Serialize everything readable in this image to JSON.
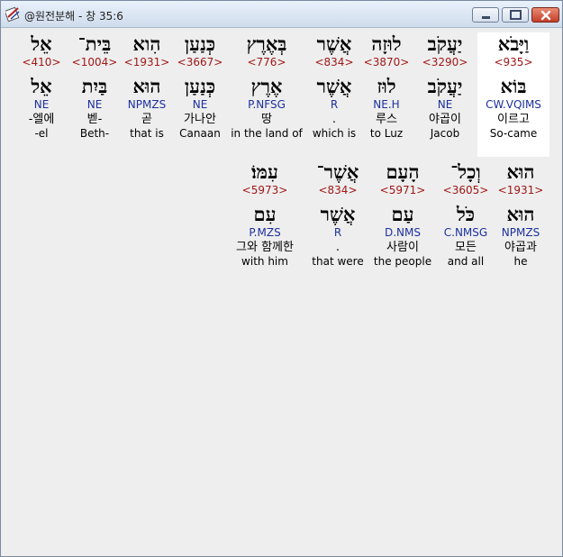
{
  "window": {
    "title": "@원전분해 - 창 35:6"
  },
  "colors": {
    "strong_number": "#a01818",
    "parsing": "#1c2fa0",
    "highlight_background": "#ffffff"
  },
  "rows": [
    {
      "words": [
        {
          "heb": "וַיָּבֹא",
          "num": "<935>",
          "lemma": "בּוֹא",
          "parse": "CW.VQIMS",
          "kor": "이르고",
          "eng": "So-came"
        },
        {
          "heb": "יַעֲקֹב",
          "num": "<3290>",
          "lemma": "יַעֲקֹב",
          "parse": "NE",
          "kor": "야곱이",
          "eng": "Jacob"
        },
        {
          "heb": "לוּזָה",
          "num": "<3870>",
          "lemma": "לוּז",
          "parse": "NE.H",
          "kor": "루스",
          "eng": "to Luz"
        },
        {
          "heb": "אֲשֶׁר",
          "num": "<834>",
          "lemma": "אֲשֶׁר",
          "parse": "R",
          "kor": ".",
          "eng": "which is"
        },
        {
          "heb": "בְּאֶרֶץ",
          "num": "<776>",
          "lemma": "אֶרֶץ",
          "parse": "P.NFSG",
          "kor": "땅",
          "eng": "in the land of"
        },
        {
          "heb": "כְּנַעַן",
          "num": "<3667>",
          "lemma": "כְּנַעַן",
          "parse": "NE",
          "kor": "가나안",
          "eng": "Canaan"
        },
        {
          "heb": "הִוא",
          "num": "<1931>",
          "lemma": "הוּא",
          "parse": "NPMZS",
          "kor": "곧",
          "eng": "that is"
        },
        {
          "heb": "בֵּית־",
          "num": "<1004>",
          "lemma": "בַּיִת",
          "parse": "NE",
          "kor": "벧-",
          "eng": "Beth-"
        },
        {
          "heb": "אֵל",
          "num": "<410>",
          "lemma": "אֵל",
          "parse": "NE",
          "kor": "-엘에",
          "eng": "-el"
        }
      ]
    },
    {
      "words": [
        {
          "heb": "הוּא",
          "num": "<1931>",
          "lemma": "הוּא",
          "parse": "NPMZS",
          "kor": "야곱과",
          "eng": "he"
        },
        {
          "heb": "וְכָל־",
          "num": "<3605>",
          "lemma": "כֹּל",
          "parse": "C.NMSG",
          "kor": "모든",
          "eng": "and all"
        },
        {
          "heb": "הָעָם",
          "num": "<5971>",
          "lemma": "עַם",
          "parse": "D.NMS",
          "kor": "사람이",
          "eng": "the people"
        },
        {
          "heb": "אֲשֶׁר־",
          "num": "<834>",
          "lemma": "אֲשֶׁר",
          "parse": "R",
          "kor": ".",
          "eng": "that were"
        },
        {
          "heb": "עִמּוֹ׃",
          "num": "<5973>",
          "lemma": "עִם",
          "parse": "P.MZS",
          "kor": "그와 함께한",
          "eng": "with him"
        }
      ]
    }
  ]
}
